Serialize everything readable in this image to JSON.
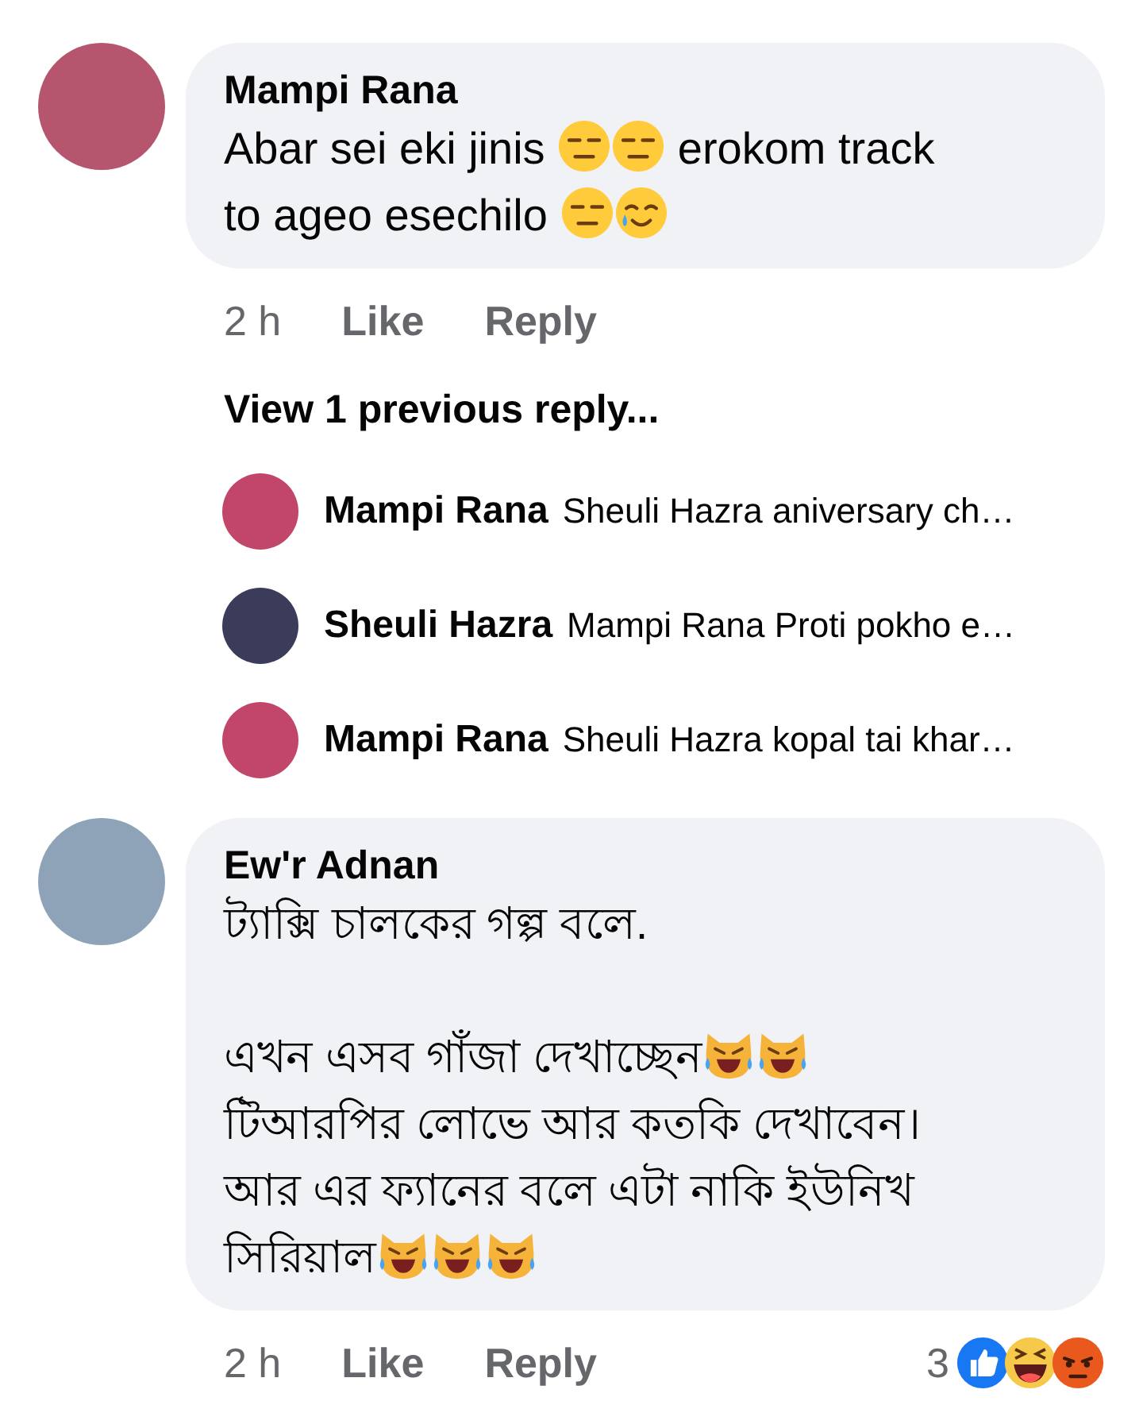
{
  "comments": [
    {
      "author": "Mampi Rana",
      "paragraphs": [
        {
          "spaced": false,
          "segments": [
            {
              "kind": "text",
              "text": "Abar sei eki jinis "
            },
            {
              "kind": "expressionless"
            },
            {
              "kind": "expressionless"
            },
            {
              "kind": "text",
              "text": " erokom track"
            }
          ]
        },
        {
          "spaced": false,
          "segments": [
            {
              "kind": "text",
              "text": "to ageo esechilo "
            },
            {
              "kind": "expressionless"
            },
            {
              "kind": "sad-tear"
            }
          ]
        }
      ],
      "time": "2 h",
      "actions": [
        "Like",
        "Reply"
      ],
      "view_replies": "View 1 previous reply...",
      "replies": [
        {
          "author": "Mampi Rana",
          "text": "Sheuli Hazra aniversary ch…"
        },
        {
          "author": "Sheuli Hazra",
          "text": "Mampi Rana Proti pokho e…"
        },
        {
          "author": "Mampi Rana",
          "text": "Sheuli Hazra kopal tai khar…"
        }
      ]
    },
    {
      "author": "Ew'r Adnan",
      "paragraphs": [
        {
          "spaced": false,
          "segments": [
            {
              "kind": "text",
              "text": "ট্যাক্সি চালকের গল্প বলে."
            }
          ]
        },
        {
          "spaced": true,
          "segments": [
            {
              "kind": "text",
              "text": "এখন এসব গাঁজা দেখাচ্ছেন"
            },
            {
              "kind": "cat-joy"
            },
            {
              "kind": "cat-joy"
            }
          ]
        },
        {
          "spaced": false,
          "segments": [
            {
              "kind": "text",
              "text": "টিআরপির লোভে আর কতকি দেখাবেন।"
            }
          ]
        },
        {
          "spaced": false,
          "segments": [
            {
              "kind": "text",
              "text": "আর এর ফ্যানের বলে এটা নাকি ইউনিখ"
            }
          ]
        },
        {
          "spaced": false,
          "segments": [
            {
              "kind": "text",
              "text": "সিরিয়াল"
            },
            {
              "kind": "cat-joy"
            },
            {
              "kind": "cat-joy"
            },
            {
              "kind": "cat-joy"
            }
          ]
        }
      ],
      "time": "2 h",
      "actions": [
        "Like",
        "Reply"
      ],
      "reaction_count": "3",
      "reactions": [
        {
          "kind": "like"
        },
        {
          "kind": "haha"
        },
        {
          "kind": "angry"
        }
      ]
    }
  ]
}
